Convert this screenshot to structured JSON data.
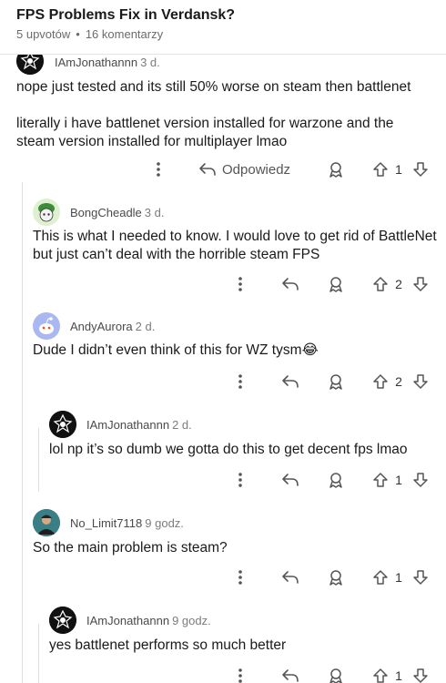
{
  "post": {
    "title": "FPS Problems Fix in Verdansk?",
    "upvotes": "5 upvotów",
    "separator": "•",
    "comments": "16 komentarzy"
  },
  "labels": {
    "reply": "Odpowiedz"
  },
  "comments": [
    {
      "author": "IAmJonathannn",
      "time": "3 d.",
      "paragraphs": [
        "nope just tested and its still 50% worse on steam then battlenet",
        "literally i have battlenet version installed for warzone and the steam version installed for multiplayer lmao"
      ],
      "votes": "1"
    },
    {
      "author": "BongCheadle",
      "time": "3 d.",
      "paragraphs": [
        "This is what I needed to know. I would love to get rid of BattleNet but just can’t deal with the horrible steam FPS"
      ],
      "votes": "2"
    },
    {
      "author": "AndyAurora",
      "time": "2 d.",
      "paragraphs": [
        "Dude I didn’t even think of this for WZ tysm😂"
      ],
      "votes": "2"
    },
    {
      "author": "IAmJonathannn",
      "time": "2 d.",
      "paragraphs": [
        "lol np it’s so dumb we gotta do this to get decent fps lmao"
      ],
      "votes": "1"
    },
    {
      "author": "No_Limit7118",
      "time": "9 godz.",
      "paragraphs": [
        "So the main problem is steam?"
      ],
      "votes": "1"
    },
    {
      "author": "IAmJonathannn",
      "time": "9 godz.",
      "paragraphs": [
        "yes battlenet performs so much better"
      ],
      "votes": "1"
    }
  ]
}
